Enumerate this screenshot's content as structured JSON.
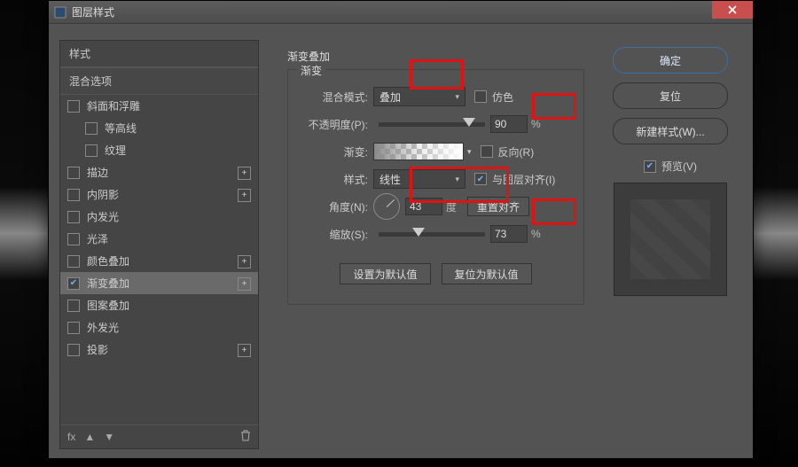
{
  "window": {
    "title": "图层样式"
  },
  "styles_header": "样式",
  "blend_options": "混合选项",
  "style_items": [
    {
      "label": "斜面和浮雕",
      "checked": false,
      "plus": false,
      "sub": false,
      "sel": false
    },
    {
      "label": "等高线",
      "checked": false,
      "plus": false,
      "sub": true,
      "sel": false
    },
    {
      "label": "纹理",
      "checked": false,
      "plus": false,
      "sub": true,
      "sel": false
    },
    {
      "label": "描边",
      "checked": false,
      "plus": true,
      "sub": false,
      "sel": false
    },
    {
      "label": "内阴影",
      "checked": false,
      "plus": true,
      "sub": false,
      "sel": false
    },
    {
      "label": "内发光",
      "checked": false,
      "plus": false,
      "sub": false,
      "sel": false
    },
    {
      "label": "光泽",
      "checked": false,
      "plus": false,
      "sub": false,
      "sel": false
    },
    {
      "label": "颜色叠加",
      "checked": false,
      "plus": true,
      "sub": false,
      "sel": false
    },
    {
      "label": "渐变叠加",
      "checked": true,
      "plus": true,
      "sub": false,
      "sel": true
    },
    {
      "label": "图案叠加",
      "checked": false,
      "plus": false,
      "sub": false,
      "sel": false
    },
    {
      "label": "外发光",
      "checked": false,
      "plus": false,
      "sub": false,
      "sel": false
    },
    {
      "label": "投影",
      "checked": false,
      "plus": true,
      "sub": false,
      "sel": false
    }
  ],
  "footer_fx": "fx",
  "panel": {
    "section": "渐变叠加",
    "legend": "渐变",
    "blend_mode_label": "混合模式:",
    "blend_mode_value": "叠加",
    "dither_label": "仿色",
    "opacity_label": "不透明度(P):",
    "opacity_value": "90",
    "gradient_label": "渐变:",
    "reverse_label": "反向(R)",
    "style_label": "样式:",
    "style_value": "线性",
    "align_label": "与图层对齐(I)",
    "angle_label": "角度(N):",
    "angle_value": "43",
    "angle_unit": "度",
    "reset_align": "重置对齐",
    "scale_label": "缩放(S):",
    "scale_value": "73",
    "pct": "%",
    "make_default": "设置为默认值",
    "reset_default": "复位为默认值"
  },
  "buttons": {
    "ok": "确定",
    "cancel": "复位",
    "new_style": "新建样式(W)...",
    "preview": "预览(V)"
  }
}
